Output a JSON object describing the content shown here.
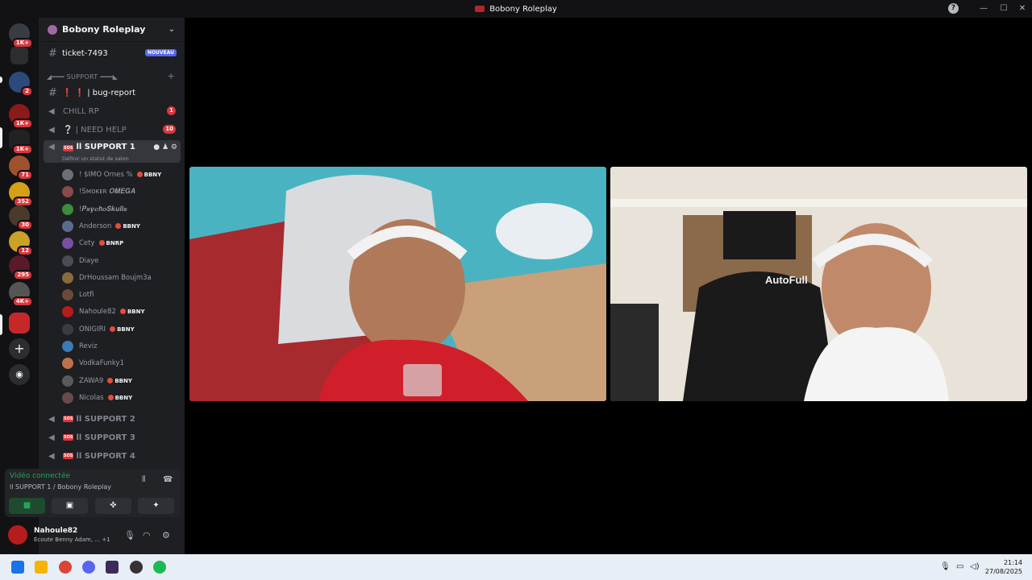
{
  "window": {
    "title": "Bobony Roleplay",
    "help": "?"
  },
  "server_rail": {
    "badges": [
      "1K+",
      "2",
      "1K+",
      "1K+",
      "71",
      "352",
      "30",
      "12",
      "295",
      "4K+"
    ]
  },
  "guild": {
    "name": "Bobony Roleplay"
  },
  "channels": {
    "ticket": {
      "name": "ticket-7493",
      "tag": "NOUVEAU"
    },
    "category": "◢━━━ SUPPORT ━━━◣",
    "bug": {
      "name": "❗ ❗ | bug-report"
    },
    "chill": {
      "name": "CHILL RP",
      "count": "1"
    },
    "needhelp": {
      "name": "❔ | NEED HELP",
      "count": "10"
    },
    "support1": {
      "name": "ll SUPPORT 1",
      "status": "Définir un statut de salon"
    },
    "support2": {
      "name": "ll SUPPORT 2"
    },
    "support3": {
      "name": "ll SUPPORT 3"
    },
    "support4": {
      "name": "ll SUPPORT 4"
    }
  },
  "voice_users": [
    {
      "name": "! $IMO Ornes %",
      "tag": "BBNY",
      "color": "#6d6f78"
    },
    {
      "name": "!Sᴍᴏᴋᴇʀ 𝑶𝑴𝑬𝑮𝑨",
      "tag": "",
      "color": "#8a4a4a"
    },
    {
      "name": "!𝑷𝒔𝒚𝒄𝒉𝒐𝑺𝒌𝒖𝒍𝒍𝒔",
      "tag": "",
      "color": "#3e8a3e"
    },
    {
      "name": "Anderson",
      "tag": "BBNY",
      "color": "#5d6a8f"
    },
    {
      "name": "Cety",
      "tag": "BNRP",
      "color": "#7a4fa0"
    },
    {
      "name": "Diaye",
      "tag": "",
      "color": "#4a4d55"
    },
    {
      "name": "DrHoussam Boujm3a",
      "tag": "",
      "color": "#8a6a3a"
    },
    {
      "name": "Lotfi",
      "tag": "",
      "color": "#6b4a3a"
    },
    {
      "name": "Nahoule82",
      "tag": "BBNY",
      "color": "#b71c1c"
    },
    {
      "name": "ONIGIRI",
      "tag": "BBNY",
      "color": "#3a3c43"
    },
    {
      "name": "Reviz",
      "tag": "",
      "color": "#3a7ab5"
    },
    {
      "name": "VodkaFunky1",
      "tag": "",
      "color": "#c0704a"
    },
    {
      "name": "ZAWA9",
      "tag": "BBNY",
      "color": "#5a5a5a"
    },
    {
      "name": "Nicolas",
      "tag": "BBNY",
      "color": "#6a4a4a"
    }
  ],
  "voice_panel": {
    "status": "Vidéo connectée",
    "channel": "ll SUPPORT 1 / Bobony Roleplay"
  },
  "user": {
    "name": "Nahoule82",
    "status": "Écoute Benny Adam, ...",
    "plus": "+1"
  },
  "taskbar": {
    "time": "21:14",
    "date": "27/08/2025"
  },
  "video": {
    "right_chair_text": "AutoFull"
  }
}
